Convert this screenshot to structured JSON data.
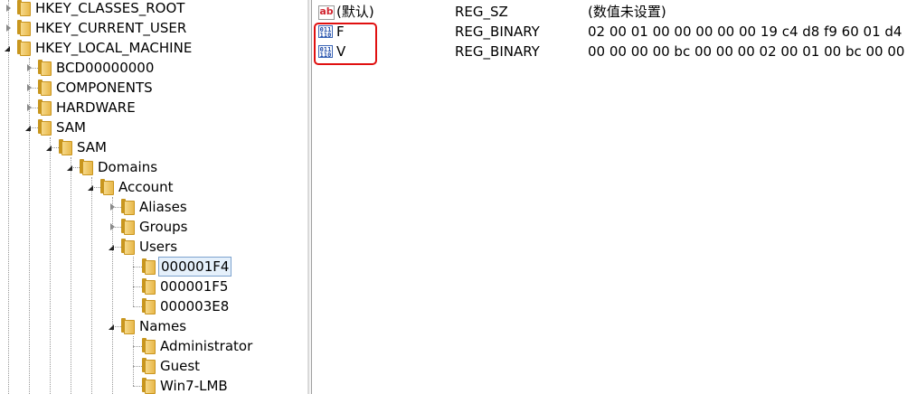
{
  "tree": [
    {
      "label": "HKEY_CLASSES_ROOT",
      "state": "collapsed"
    },
    {
      "label": "HKEY_CURRENT_USER",
      "state": "collapsed"
    },
    {
      "label": "HKEY_LOCAL_MACHINE",
      "state": "expanded"
    },
    {
      "label": "BCD00000000",
      "state": "collapsed"
    },
    {
      "label": "COMPONENTS",
      "state": "collapsed"
    },
    {
      "label": "HARDWARE",
      "state": "collapsed"
    },
    {
      "label": "SAM",
      "state": "expanded"
    },
    {
      "label": "SAM",
      "state": "expanded"
    },
    {
      "label": "Domains",
      "state": "expanded"
    },
    {
      "label": "Account",
      "state": "expanded"
    },
    {
      "label": "Aliases",
      "state": "collapsed"
    },
    {
      "label": "Groups",
      "state": "collapsed"
    },
    {
      "label": "Users",
      "state": "expanded"
    },
    {
      "label": "000001F4",
      "state": "leaf",
      "selected": true
    },
    {
      "label": "000001F5",
      "state": "leaf"
    },
    {
      "label": "000003E8",
      "state": "leaf"
    },
    {
      "label": "Names",
      "state": "expanded"
    },
    {
      "label": "Administrator",
      "state": "leaf"
    },
    {
      "label": "Guest",
      "state": "leaf"
    },
    {
      "label": "Win7-LMB",
      "state": "leaf"
    }
  ],
  "values": [
    {
      "name": "(默认)",
      "type": "REG_SZ",
      "data": "(数值未设置)",
      "icon": "string-value-icon",
      "icon_text": "ab"
    },
    {
      "name": "F",
      "type": "REG_BINARY",
      "data": "02 00 01 00 00 00 00 00 19 c4 d8 f9 60 01 d4 0...",
      "icon": "binary-value-icon",
      "icon_text": "011 110"
    },
    {
      "name": "V",
      "type": "REG_BINARY",
      "data": "00 00 00 00 bc 00 00 00 02 00 01 00 bc 00 00 ...",
      "icon": "binary-value-icon",
      "icon_text": "011 110"
    }
  ],
  "colors": {
    "highlight": "#e01010",
    "selection_bg": "#e5f0fb",
    "selection_border": "#7da2ce",
    "folder": "#e8b84a"
  }
}
